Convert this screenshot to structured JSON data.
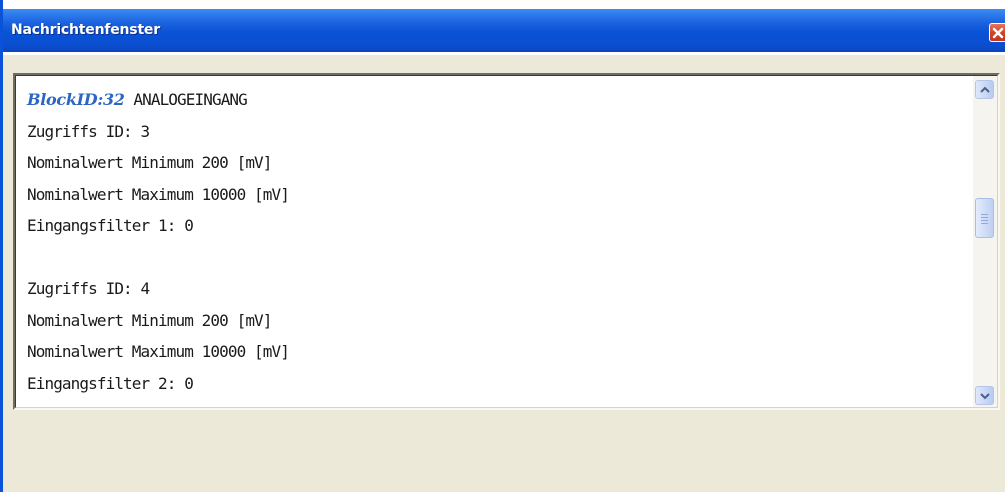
{
  "window": {
    "title": "Nachrichtenfenster"
  },
  "message": {
    "block_id_label": "BlockID:32",
    "block_type": " ANALOGEINGANG",
    "lines": [
      "Zugriffs ID: 3",
      "Nominalwert Minimum 200 [mV]",
      "Nominalwert Maximum 10000 [mV]",
      "Eingangsfilter 1: 0",
      "",
      "Zugriffs ID: 4",
      "Nominalwert Minimum 200 [mV]",
      "Nominalwert Maximum 10000 [mV]",
      "Eingangsfilter 2: 0"
    ]
  },
  "icons": {
    "close": "close-icon",
    "scroll_up": "chevron-up-icon",
    "scroll_down": "chevron-down-icon"
  },
  "colors": {
    "titlebar": "#0a52d6",
    "close_button": "#d2442a",
    "block_id": "#2a66c2",
    "dialog_background": "#ece9d8"
  }
}
